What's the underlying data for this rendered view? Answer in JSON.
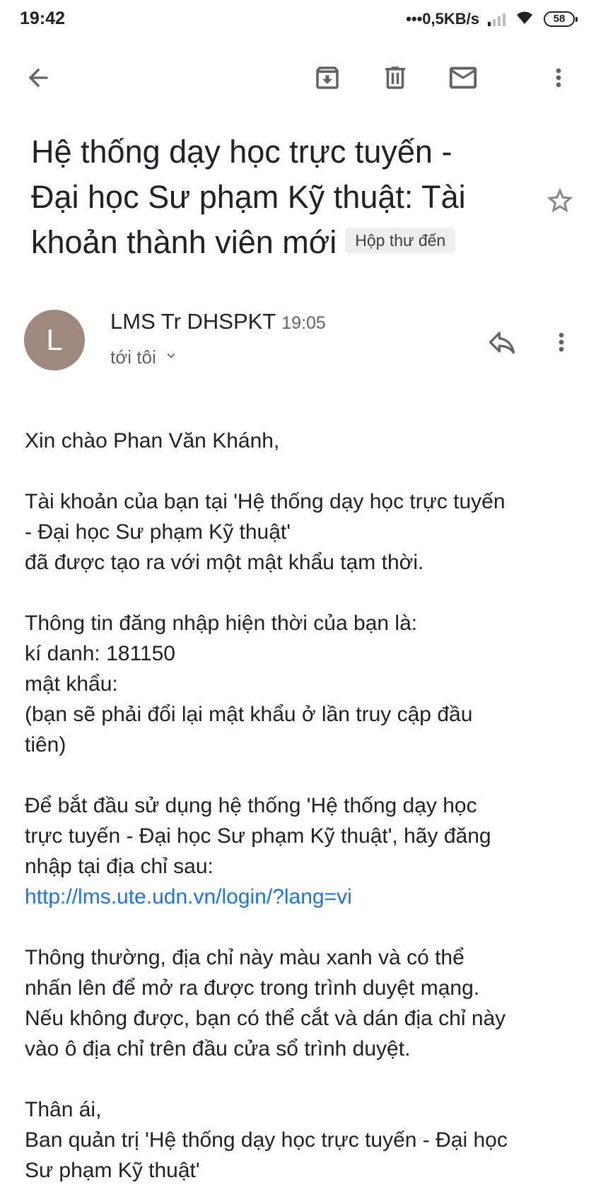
{
  "status_bar": {
    "time": "19:42",
    "net_speed": "•••0,5KB/s",
    "battery": "58"
  },
  "toolbar": {
    "icons": [
      "back-arrow-icon",
      "archive-icon",
      "trash-icon",
      "mail-icon",
      "more-vert-icon"
    ]
  },
  "subject": {
    "line1": "Hệ thống dạy học trực tuyến -",
    "line2": "Đại học Sư phạm Kỹ thuật: Tài",
    "line3": "khoản thành viên mới",
    "label": "Hộp thư đến"
  },
  "sender": {
    "avatar_letter": "L",
    "avatar_color": "#a1887f",
    "name": "LMS Tr DHSPKT",
    "time": "19:05",
    "recipient": "tới tôi"
  },
  "body": {
    "greeting": "Xin chào Phan Văn Khánh,",
    "p1_line1": "Tài khoản của bạn tại 'Hệ thống dạy học trực tuyến",
    "p1_line2": "- Đại học Sư phạm Kỹ thuật'",
    "p1_line3": "đã được tạo ra với một mật khẩu tạm thời.",
    "p2_line1": "Thông tin đăng nhập hiện thời của bạn là:",
    "username_label": "kí danh: 181150",
    "password_label": "mật khẩu: ",
    "p2_line4": "(bạn sẽ phải đổi lại mật khẩu ở lần truy cập đầu",
    "p2_line5": "tiên)",
    "p3_line1": "Để bắt đầu sử dụng hệ thống 'Hệ thống dạy học",
    "p3_line2": "trực tuyến - Đại học Sư phạm Kỹ thuật', hãy đăng",
    "p3_line3": "nhập tại địa chỉ sau:",
    "login_link": "http://lms.ute.udn.vn/login/?lang=vi",
    "p4_line1": "Thông thường, địa chỉ này màu xanh và có thể",
    "p4_line2": "nhấn lên để mở ra được trong trình duyệt mạng.",
    "p4_line3": "Nếu không được, bạn có thể cắt và dán địa chỉ này",
    "p4_line4": "vào ô địa chỉ trên đầu cửa sổ trình duyệt.",
    "closing": "Thân ái,",
    "signature_line1": "Ban quản trị 'Hệ thống dạy học trực tuyến - Đại học",
    "signature_line2": "Sư phạm Kỹ thuật'"
  },
  "colors": {
    "link": "#1a73e8",
    "text": "#202124",
    "secondary_text": "#5f6368"
  }
}
